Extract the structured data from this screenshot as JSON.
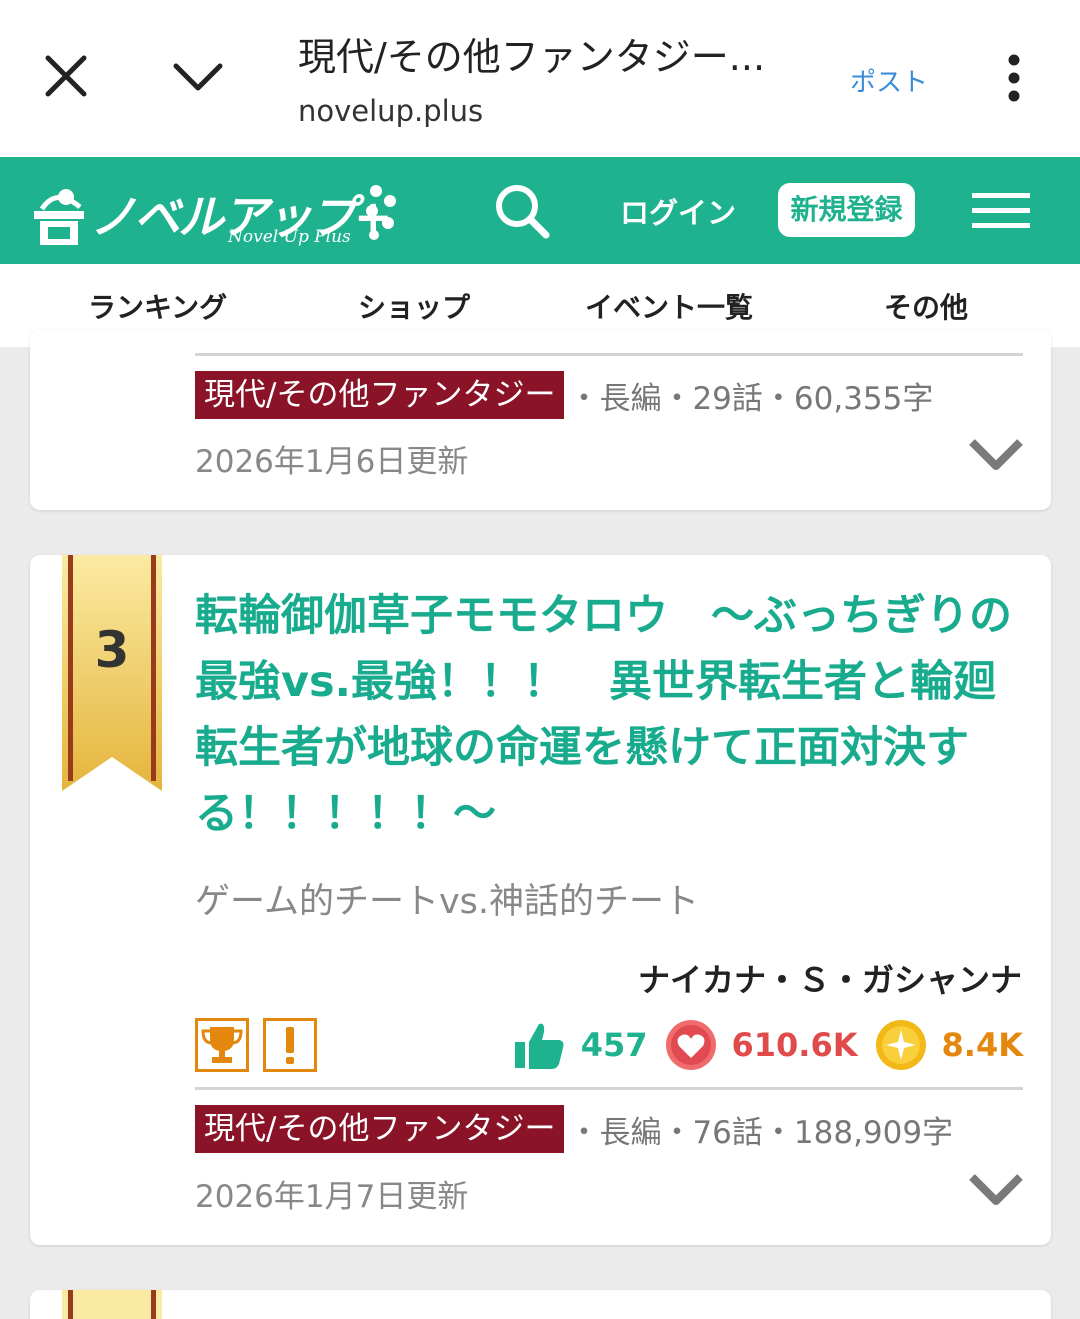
{
  "browser": {
    "title": "現代/その他ファンタジー...",
    "url": "novelup.plus",
    "post_label": "ポスト"
  },
  "site": {
    "logo_text": "ノベルアップ+",
    "logo_sub": "Novel Up Plus",
    "login_label": "ログイン",
    "register_label": "新規登録",
    "brand_color": "#1fb28f"
  },
  "subnav": {
    "items": [
      {
        "label": "ランキング"
      },
      {
        "label": "ショップ"
      },
      {
        "label": "イベント一覧"
      },
      {
        "label": "その他"
      }
    ]
  },
  "cards": [
    {
      "genre": "現代/その他ファンタジー",
      "meta": "・長編・29話・60,355字",
      "updated": "2026年1月6日更新"
    },
    {
      "rank": "3",
      "title": "転輪御伽草子モモタロウ　～ぶっちぎりの最強vs.最強！！！　異世界転生者と輪廻転生者が地球の命運を懸けて正面対決する！！！！！～",
      "catch": "ゲーム的チートvs.神話的チート",
      "author": "ナイカナ・Ｓ・ガシャンナ",
      "badges": [
        "trophy-icon",
        "exclamation-icon"
      ],
      "likes": "457",
      "hearts": "610.6K",
      "points": "8.4K",
      "genre": "現代/その他ファンタジー",
      "meta": "・長編・76話・188,909字",
      "updated": "2026年1月7日更新"
    }
  ]
}
